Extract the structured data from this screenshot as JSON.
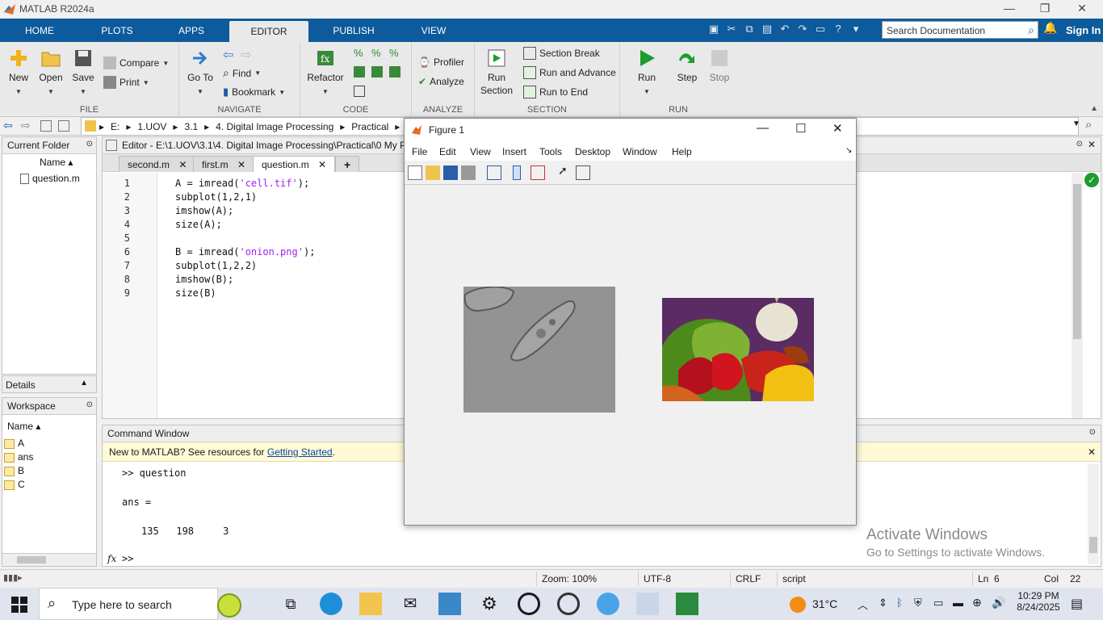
{
  "window": {
    "title": "MATLAB R2024a"
  },
  "tabs": [
    "HOME",
    "PLOTS",
    "APPS",
    "EDITOR",
    "PUBLISH",
    "VIEW"
  ],
  "active_tab": "EDITOR",
  "search": {
    "placeholder": "Search Documentation"
  },
  "signin": "Sign In",
  "ribbon": {
    "file": {
      "label": "FILE",
      "new": "New",
      "open": "Open",
      "save": "Save",
      "compare": "Compare",
      "print": "Print"
    },
    "navigate": {
      "label": "NAVIGATE",
      "goto_line1": "Go To",
      "find": "Find",
      "bookmark": "Bookmark"
    },
    "code": {
      "label": "CODE",
      "refactor": "Refactor"
    },
    "analyze": {
      "label": "ANALYZE",
      "profiler": "Profiler",
      "analyze": "Analyze"
    },
    "section": {
      "label": "SECTION",
      "run_section_1": "Run",
      "run_section_2": "Section",
      "section_break": "Section Break",
      "run_and_advance": "Run and Advance",
      "run_to_end": "Run to End"
    },
    "run": {
      "label": "RUN",
      "run": "Run",
      "step": "Step",
      "stop": "Stop"
    }
  },
  "address": {
    "crumbs": [
      "E:",
      "1.UOV",
      "3.1",
      "4. Digital Image Processing",
      "Practical",
      "0 M"
    ]
  },
  "current_folder": {
    "title": "Current Folder",
    "col": "Name",
    "files": [
      "question.m"
    ]
  },
  "details": {
    "title": "Details"
  },
  "workspace": {
    "title": "Workspace",
    "col": "Name",
    "vars": [
      "A",
      "ans",
      "B",
      "C"
    ]
  },
  "editor": {
    "title": "Editor - E:\\1.UOV\\3.1\\4. Digital Image Processing\\Practical\\0 My Pr",
    "tabs": [
      "second.m",
      "first.m",
      "question.m"
    ],
    "active_tab": "question.m",
    "lines": [
      {
        "n": "1",
        "pre": "A = imread(",
        "str": "'cell.tif'",
        "post": ");"
      },
      {
        "n": "2",
        "pre": "subplot(1,2,1)",
        "str": "",
        "post": ""
      },
      {
        "n": "3",
        "pre": "imshow(A);",
        "str": "",
        "post": ""
      },
      {
        "n": "4",
        "pre": "size(A);",
        "str": "",
        "post": ""
      },
      {
        "n": "5",
        "pre": "",
        "str": "",
        "post": ""
      },
      {
        "n": "6",
        "pre": "B = imread(",
        "str": "'onion.png'",
        "post": ");"
      },
      {
        "n": "7",
        "pre": "subplot(1,2,2)",
        "str": "",
        "post": ""
      },
      {
        "n": "8",
        "pre": "imshow(B);",
        "str": "",
        "post": ""
      },
      {
        "n": "9",
        "pre": "size(B)",
        "str": "",
        "post": ""
      }
    ]
  },
  "command_window": {
    "title": "Command Window",
    "banner_text": "New to MATLAB? See resources for ",
    "banner_link": "Getting Started",
    "banner_end": ".",
    "prompt_line": ">> question",
    "ans_line": "ans =",
    "values": "135   198     3",
    "prompt": ">>"
  },
  "figure": {
    "title": "Figure 1",
    "menus": [
      "File",
      "Edit",
      "View",
      "Insert",
      "Tools",
      "Desktop",
      "Window",
      "Help"
    ]
  },
  "status": {
    "zoom": "Zoom: 100%",
    "encoding": "UTF-8",
    "eol": "CRLF",
    "mode": "script",
    "ln_label": "Ln",
    "ln": "6",
    "col_label": "Col",
    "col": "22"
  },
  "watermark": {
    "line1": "Activate Windows",
    "line2": "Go to Settings to activate Windows."
  },
  "taskbar": {
    "search": "Type here to search",
    "temp": "31°C",
    "time": "10:29 PM",
    "date": "8/24/2025"
  },
  "colors": {
    "accent": "#0d5a9c",
    "run_green": "#1e9c2e",
    "string_purple": "#a020f0"
  }
}
